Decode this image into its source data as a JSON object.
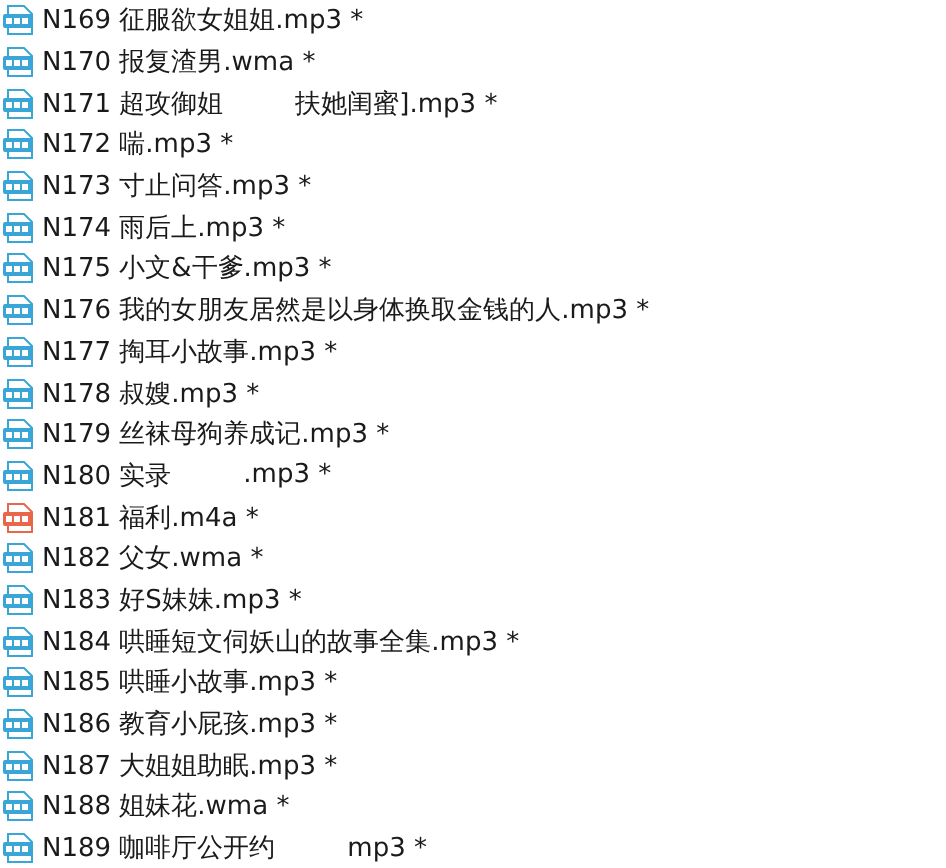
{
  "files": [
    {
      "kind": "mp3",
      "name": "N169 征服欲女姐姐.mp3 *"
    },
    {
      "kind": "wma",
      "name": "N170 报复渣男.wma *"
    },
    {
      "kind": "mp3",
      "name": "N171 超攻御姐",
      "after_gap": "扶她闺蜜].mp3 *"
    },
    {
      "kind": "mp3",
      "name": "N172 喘.mp3 *"
    },
    {
      "kind": "mp3",
      "name": "N173 寸止问答.mp3 *"
    },
    {
      "kind": "mp3",
      "name": "N174 雨后上.mp3 *"
    },
    {
      "kind": "mp3",
      "name": "N175 小文&干爹.mp3 *"
    },
    {
      "kind": "mp3",
      "name": "N176 我的女朋友居然是以身体换取金钱的人.mp3 *"
    },
    {
      "kind": "mp3",
      "name": "N177 掏耳小故事.mp3 *"
    },
    {
      "kind": "mp3",
      "name": "N178 叔嫂.mp3 *"
    },
    {
      "kind": "mp3",
      "name": "N179 丝袜母狗养成记.mp3 *"
    },
    {
      "kind": "mp3",
      "name": "N180 实录",
      "after_gap": ".mp3 *"
    },
    {
      "kind": "m4a",
      "name": "N181 福利.m4a *"
    },
    {
      "kind": "wma",
      "name": "N182 父女.wma *"
    },
    {
      "kind": "mp3",
      "name": "N183 好S妹妹.mp3 *"
    },
    {
      "kind": "mp3",
      "name": "N184 哄睡短文伺妖山的故事全集.mp3 *"
    },
    {
      "kind": "mp3",
      "name": "N185 哄睡小故事.mp3 *"
    },
    {
      "kind": "mp3",
      "name": "N186 教育小屁孩.mp3 *"
    },
    {
      "kind": "mp3",
      "name": "N187 大姐姐助眠.mp3 *"
    },
    {
      "kind": "wma",
      "name": "N188 姐妹花.wma *"
    },
    {
      "kind": "mp3",
      "name": "N189 咖啡厅公开约",
      "after_gap": "mp3 *"
    }
  ]
}
